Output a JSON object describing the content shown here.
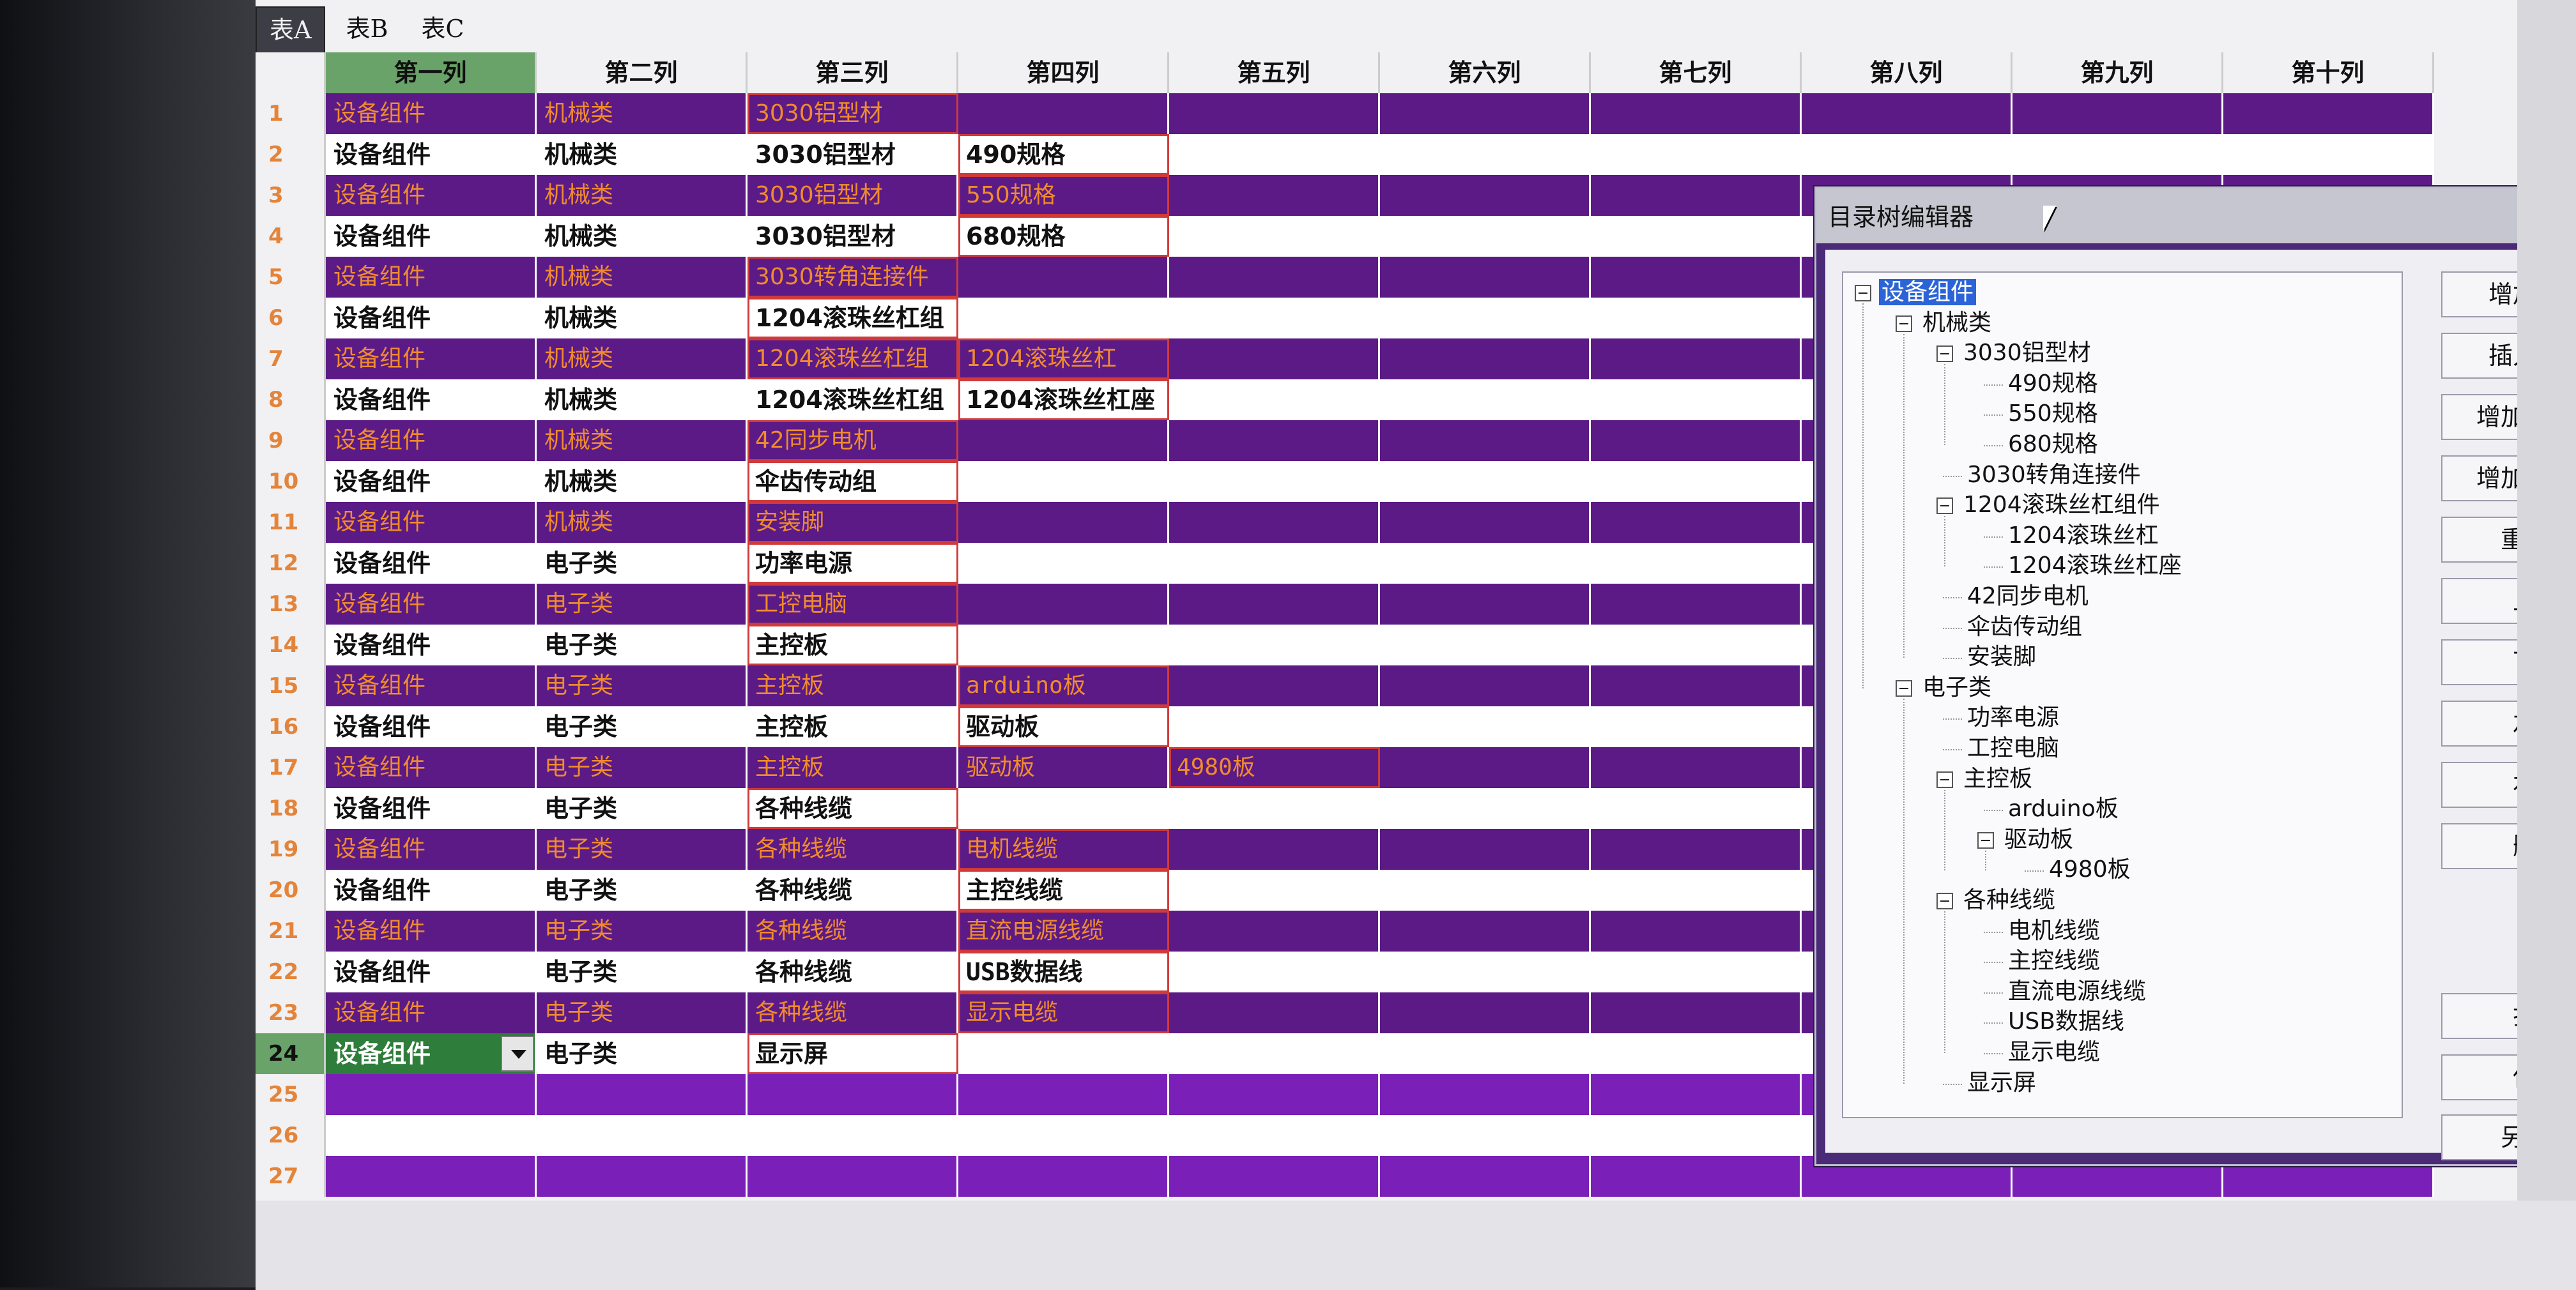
{
  "tabs": [
    {
      "label": "表A",
      "active": true
    },
    {
      "label": "表B",
      "active": false
    },
    {
      "label": "表C",
      "active": false
    }
  ],
  "columns": [
    "第一列",
    "第二列",
    "第三列",
    "第四列",
    "第五列",
    "第六列",
    "第七列",
    "第八列",
    "第九列",
    "第十列"
  ],
  "rows": [
    {
      "num": "1",
      "cells": [
        "设备组件",
        "机械类",
        "3030铝型材",
        "",
        "",
        "",
        "",
        "",
        "",
        ""
      ]
    },
    {
      "num": "2",
      "cells": [
        "设备组件",
        "机械类",
        "3030铝型材",
        "490规格",
        "",
        "",
        "",
        "",
        "",
        ""
      ]
    },
    {
      "num": "3",
      "cells": [
        "设备组件",
        "机械类",
        "3030铝型材",
        "550规格",
        "",
        "",
        "",
        "",
        "",
        ""
      ]
    },
    {
      "num": "4",
      "cells": [
        "设备组件",
        "机械类",
        "3030铝型材",
        "680规格",
        "",
        "",
        "",
        "",
        "",
        ""
      ]
    },
    {
      "num": "5",
      "cells": [
        "设备组件",
        "机械类",
        "3030转角连接件",
        "",
        "",
        "",
        "",
        "",
        "",
        ""
      ]
    },
    {
      "num": "6",
      "cells": [
        "设备组件",
        "机械类",
        "1204滚珠丝杠组",
        "",
        "",
        "",
        "",
        "",
        "",
        ""
      ]
    },
    {
      "num": "7",
      "cells": [
        "设备组件",
        "机械类",
        "1204滚珠丝杠组",
        "1204滚珠丝杠",
        "",
        "",
        "",
        "",
        "",
        ""
      ]
    },
    {
      "num": "8",
      "cells": [
        "设备组件",
        "机械类",
        "1204滚珠丝杠组",
        "1204滚珠丝杠座",
        "",
        "",
        "",
        "",
        "",
        ""
      ]
    },
    {
      "num": "9",
      "cells": [
        "设备组件",
        "机械类",
        "42同步电机",
        "",
        "",
        "",
        "",
        "",
        "",
        ""
      ]
    },
    {
      "num": "10",
      "cells": [
        "设备组件",
        "机械类",
        "伞齿传动组",
        "",
        "",
        "",
        "",
        "",
        "",
        ""
      ]
    },
    {
      "num": "11",
      "cells": [
        "设备组件",
        "机械类",
        "安装脚",
        "",
        "",
        "",
        "",
        "",
        "",
        ""
      ]
    },
    {
      "num": "12",
      "cells": [
        "设备组件",
        "电子类",
        "功率电源",
        "",
        "",
        "",
        "",
        "",
        "",
        ""
      ]
    },
    {
      "num": "13",
      "cells": [
        "设备组件",
        "电子类",
        "工控电脑",
        "",
        "",
        "",
        "",
        "",
        "",
        ""
      ]
    },
    {
      "num": "14",
      "cells": [
        "设备组件",
        "电子类",
        "主控板",
        "",
        "",
        "",
        "",
        "",
        "",
        ""
      ]
    },
    {
      "num": "15",
      "cells": [
        "设备组件",
        "电子类",
        "主控板",
        "arduino板",
        "",
        "",
        "",
        "",
        "",
        ""
      ]
    },
    {
      "num": "16",
      "cells": [
        "设备组件",
        "电子类",
        "主控板",
        "驱动板",
        "",
        "",
        "",
        "",
        "",
        ""
      ]
    },
    {
      "num": "17",
      "cells": [
        "设备组件",
        "电子类",
        "主控板",
        "驱动板",
        "4980板",
        "",
        "",
        "",
        "",
        ""
      ]
    },
    {
      "num": "18",
      "cells": [
        "设备组件",
        "电子类",
        "各种线缆",
        "",
        "",
        "",
        "",
        "",
        "",
        ""
      ]
    },
    {
      "num": "19",
      "cells": [
        "设备组件",
        "电子类",
        "各种线缆",
        "电机线缆",
        "",
        "",
        "",
        "",
        "",
        ""
      ]
    },
    {
      "num": "20",
      "cells": [
        "设备组件",
        "电子类",
        "各种线缆",
        "主控线缆",
        "",
        "",
        "",
        "",
        "",
        ""
      ]
    },
    {
      "num": "21",
      "cells": [
        "设备组件",
        "电子类",
        "各种线缆",
        "直流电源线缆",
        "",
        "",
        "",
        "",
        "",
        ""
      ]
    },
    {
      "num": "22",
      "cells": [
        "设备组件",
        "电子类",
        "各种线缆",
        "USB数据线",
        "",
        "",
        "",
        "",
        "",
        ""
      ]
    },
    {
      "num": "23",
      "cells": [
        "设备组件",
        "电子类",
        "各种线缆",
        "显示电缆",
        "",
        "",
        "",
        "",
        "",
        ""
      ]
    },
    {
      "num": "24",
      "cells": [
        "设备组件",
        "电子类",
        "显示屏",
        "",
        "",
        "",
        "",
        "",
        "",
        ""
      ]
    },
    {
      "num": "25",
      "cells": [
        "",
        "",
        "",
        "",
        "",
        "",
        "",
        "",
        "",
        ""
      ]
    },
    {
      "num": "26",
      "cells": [
        "",
        "",
        "",
        "",
        "",
        "",
        "",
        "",
        "",
        ""
      ]
    },
    {
      "num": "27",
      "cells": [
        "",
        "",
        "",
        "",
        "",
        "",
        "",
        "",
        "",
        ""
      ]
    }
  ],
  "dialog": {
    "title": "目录树编辑器",
    "tree": [
      {
        "label": "设备组件",
        "depth": 0,
        "expander": true,
        "selected": true
      },
      {
        "label": "机械类",
        "depth": 1,
        "expander": true
      },
      {
        "label": "3030铝型材",
        "depth": 2,
        "expander": true
      },
      {
        "label": "490规格",
        "depth": 3
      },
      {
        "label": "550规格",
        "depth": 3
      },
      {
        "label": "680规格",
        "depth": 3
      },
      {
        "label": "3030转角连接件",
        "depth": 2
      },
      {
        "label": "1204滚珠丝杠组件",
        "depth": 2,
        "expander": true
      },
      {
        "label": "1204滚珠丝杠",
        "depth": 3
      },
      {
        "label": "1204滚珠丝杠座",
        "depth": 3
      },
      {
        "label": "42同步电机",
        "depth": 2
      },
      {
        "label": "伞齿传动组",
        "depth": 2
      },
      {
        "label": "安装脚",
        "depth": 2
      },
      {
        "label": "电子类",
        "depth": 1,
        "expander": true
      },
      {
        "label": "功率电源",
        "depth": 2
      },
      {
        "label": "工控电脑",
        "depth": 2
      },
      {
        "label": "主控板",
        "depth": 2,
        "expander": true
      },
      {
        "label": "arduino板",
        "depth": 3
      },
      {
        "label": "驱动板",
        "depth": 3,
        "expander": true
      },
      {
        "label": "4980板",
        "depth": 4
      },
      {
        "label": "各种线缆",
        "depth": 2,
        "expander": true
      },
      {
        "label": "电机线缆",
        "depth": 3
      },
      {
        "label": "主控线缆",
        "depth": 3
      },
      {
        "label": "直流电源线缆",
        "depth": 3
      },
      {
        "label": "USB数据线",
        "depth": 3
      },
      {
        "label": "显示电缆",
        "depth": 3
      },
      {
        "label": "显示屏",
        "depth": 2
      }
    ],
    "buttons": [
      "增加节点",
      "插入节点",
      "增加根节点",
      "增加子节点",
      "重命名",
      "上移",
      "下移",
      "左移",
      "右移",
      "删除"
    ],
    "file_buttons": [
      "打开",
      "保存",
      "另存为"
    ]
  },
  "colors": {
    "purple_row": "#5b1a86",
    "orange_text": "#f08b2e",
    "selected_header": "#6aa36a",
    "active_cell": "#2e7d3a"
  }
}
